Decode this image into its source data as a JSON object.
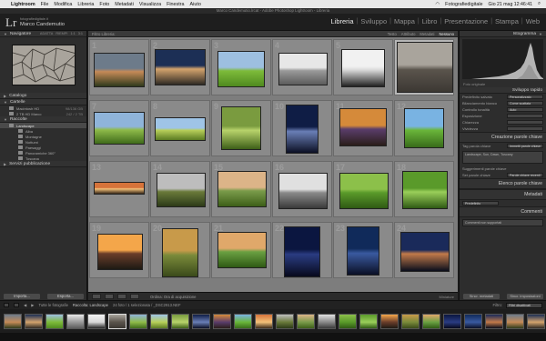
{
  "menubar": {
    "apple": "",
    "items": [
      "Lightroom",
      "File",
      "Modifica",
      "Libreria",
      "Foto",
      "Metadati",
      "Visualizza",
      "Finestra",
      "Aiuto"
    ],
    "right_text": "Fotografiedigitale",
    "clock": "Gio 21 mag 12:46:41"
  },
  "window": {
    "title": "Marco Candemutio.lrcat - Adobe Photoshop Lightroom - Libreria"
  },
  "identity": {
    "logo": "Lr",
    "small_text": "fotografiedigitale.it",
    "name": "Marco Candemutio"
  },
  "modules": [
    "Libreria",
    "Sviluppo",
    "Mappa",
    "Libro",
    "Presentazione",
    "Stampa",
    "Web"
  ],
  "active_module": "Libreria",
  "left_panel": {
    "navigator": "Navigatore",
    "navigator_opts": [
      "ADATTA",
      "RIEMPI",
      "1:1",
      "3:1"
    ],
    "catalog": "Catalogo",
    "folders": "Cartelle",
    "volumes": [
      {
        "name": "Macintosh HD",
        "count": "98/136 GB"
      },
      {
        "name": "2 TB HD Marco",
        "count": "242 / 2 TB"
      }
    ],
    "collections": "Raccolte",
    "collection_items": [
      {
        "name": "Landscape",
        "count": "",
        "selected": true
      },
      {
        "name": "Alba",
        "count": ""
      },
      {
        "name": "Montagne",
        "count": ""
      },
      {
        "name": "Notturni",
        "count": ""
      },
      {
        "name": "Paesaggi",
        "count": ""
      },
      {
        "name": "Panoramiche 360°",
        "count": ""
      },
      {
        "name": "Toscana",
        "count": ""
      }
    ],
    "publish": "Servizi pubblicazione",
    "import_btn": "Importa...",
    "export_btn": "Esporta..."
  },
  "filter_bar": {
    "title": "Filtro Libreria:",
    "options": [
      "Testo",
      "Attributo",
      "Metadati",
      "Nessuno"
    ],
    "active": "Nessuno"
  },
  "grid_thumbs": [
    {
      "num": "1"
    },
    {
      "num": "2"
    },
    {
      "num": "3"
    },
    {
      "num": "4"
    },
    {
      "num": "5"
    },
    {
      "num": "6"
    },
    {
      "num": "7"
    },
    {
      "num": "8"
    },
    {
      "num": "9"
    },
    {
      "num": "10"
    },
    {
      "num": "11"
    },
    {
      "num": "12"
    },
    {
      "num": "13"
    },
    {
      "num": "14"
    },
    {
      "num": "15"
    },
    {
      "num": "16"
    },
    {
      "num": "17"
    },
    {
      "num": "18"
    },
    {
      "num": "19"
    },
    {
      "num": "20"
    },
    {
      "num": "21"
    },
    {
      "num": "22"
    },
    {
      "num": "23"
    },
    {
      "num": "24"
    }
  ],
  "toolbar": {
    "sort_label": "Ordina: Ora di acquisizione",
    "thumb_label": "Miniature"
  },
  "right_panel": {
    "histogram": "Istogramma",
    "hist_caption": "Foto originale",
    "quick_develop": "Sviluppo rapido",
    "qd_rows": [
      {
        "label": "Predefinito salvato",
        "value": "Personalizzato"
      },
      {
        "label": "Bilanciamento bianco",
        "value": "Come scattata"
      },
      {
        "label": "Controllo tonalità",
        "value": "Auto"
      },
      {
        "label": "Esposizione",
        "value": ""
      },
      {
        "label": "Chiarezza",
        "value": ""
      },
      {
        "label": "Vividezza",
        "value": ""
      }
    ],
    "keywording": "Creazione parole chiave",
    "keyword_tags_label": "Tag parola chiave",
    "keyword_tags_value": "Immetti parole chiave",
    "keywords_text": "Landscape, Sun, Dawn, Tuscany",
    "keyword_suggestions": "Suggerimenti parole chiave",
    "keyword_set_label": "Set parole chiave",
    "keyword_set_value": "Parole chiave recenti",
    "keyword_list": "Elenco parole chiave",
    "metadata": "Metadati",
    "metadata_value": "Predefinito",
    "comments": "Commenti",
    "comments_placeholder": "Commenti non supportati",
    "sync_btn": "Sincr. metadati",
    "sync_settings_btn": "Sincr. impostazioni"
  },
  "filmstrip": {
    "path_label": "Tutte le fotografie",
    "path": "Raccolta: Landscape",
    "count": "24 foto / 1 selezionata / _DSC2913.NEF",
    "filter_label": "Filtro:",
    "filter_value": "Filtri disattivati",
    "thumbs": 26
  },
  "colors": {
    "accent": "#e8e8e8",
    "panel": "#2d2d2d",
    "grid_bg": "#7d7d7d",
    "selected_cell": "#b6b6b6"
  }
}
